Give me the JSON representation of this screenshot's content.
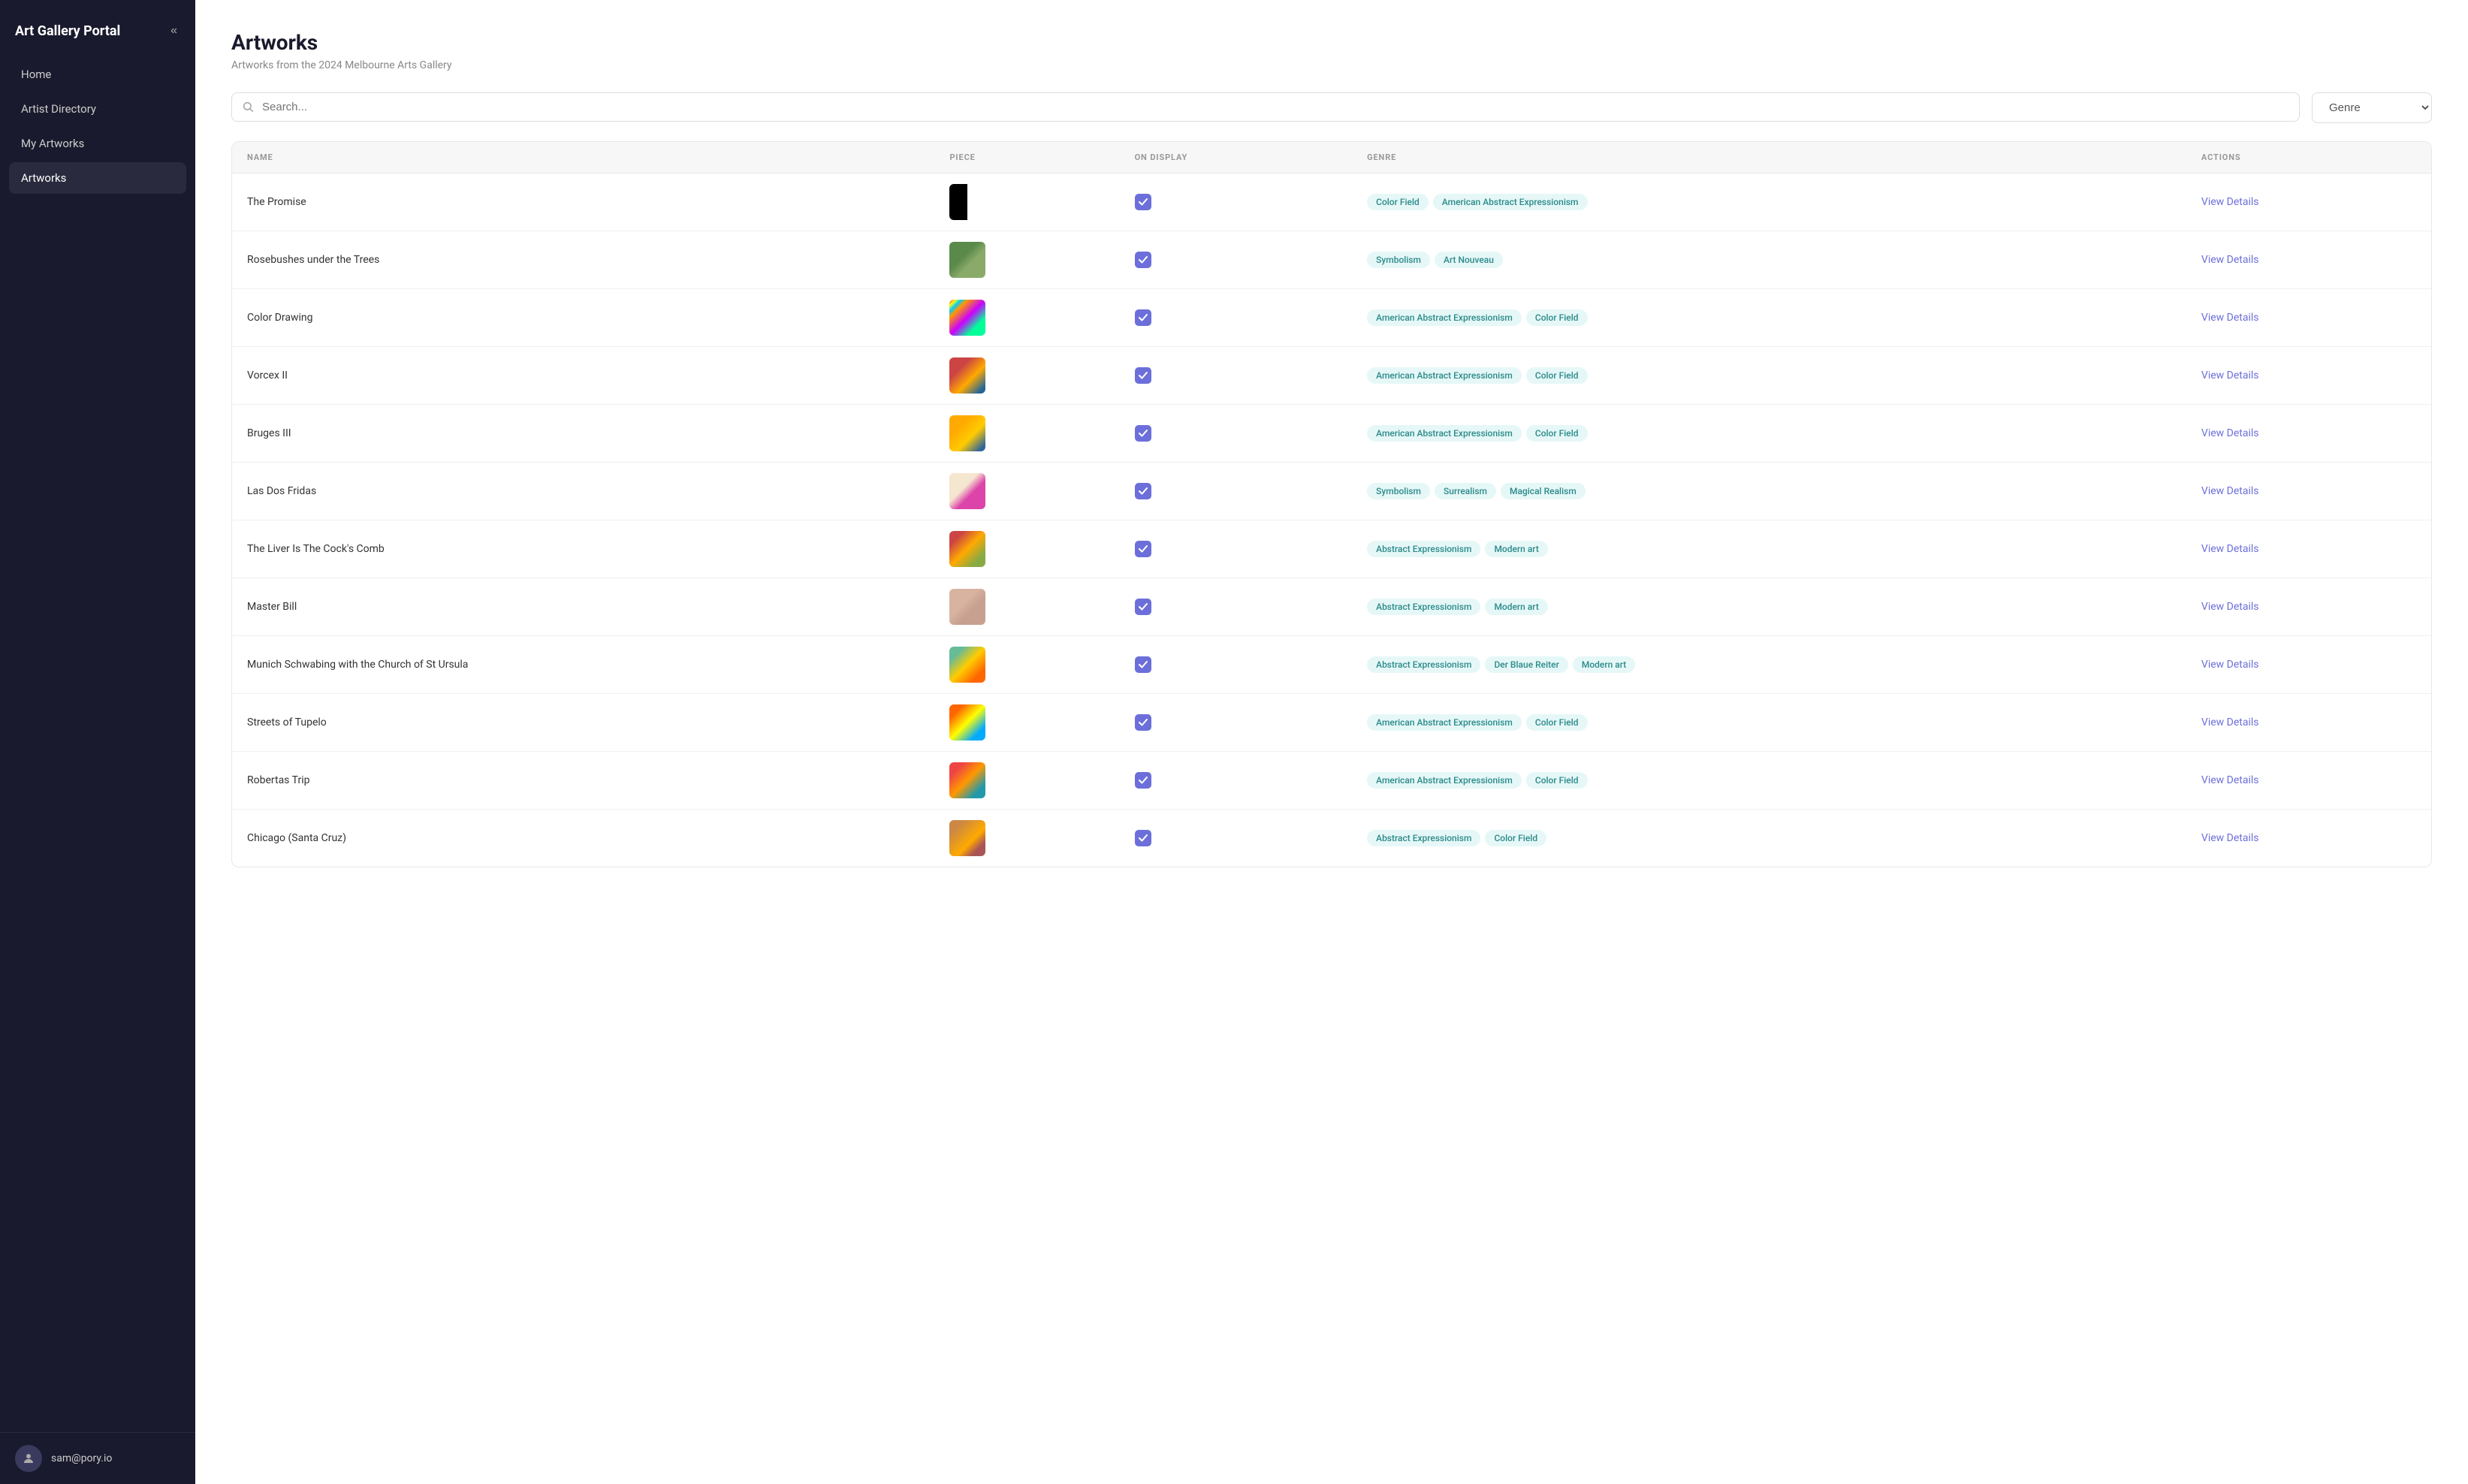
{
  "app": {
    "logo": "Art Gallery Portal",
    "collapse_icon": "«"
  },
  "sidebar": {
    "items": [
      {
        "id": "home",
        "label": "Home",
        "active": false
      },
      {
        "id": "artist-directory",
        "label": "Artist Directory",
        "active": false
      },
      {
        "id": "my-artworks",
        "label": "My Artworks",
        "active": false
      },
      {
        "id": "artworks",
        "label": "Artworks",
        "active": true
      }
    ]
  },
  "user": {
    "email": "sam@pory.io",
    "icon": "👤"
  },
  "page": {
    "title": "Artworks",
    "subtitle": "Artworks from the 2024 Melbourne Arts Gallery"
  },
  "search": {
    "placeholder": "Search...",
    "genre_placeholder": "Genre"
  },
  "table": {
    "columns": [
      "NAME",
      "PIECE",
      "ON DISPLAY",
      "GENRE",
      "ACTIONS"
    ],
    "rows": [
      {
        "name": "The Promise",
        "art_class": "art-1",
        "on_display": true,
        "genres": [
          "Color Field",
          "American Abstract Expressionism"
        ],
        "action": "View Details"
      },
      {
        "name": "Rosebushes under the Trees",
        "art_class": "art-2",
        "on_display": true,
        "genres": [
          "Symbolism",
          "Art Nouveau"
        ],
        "action": "View Details"
      },
      {
        "name": "Color Drawing",
        "art_class": "art-3",
        "on_display": true,
        "genres": [
          "American Abstract Expressionism",
          "Color Field"
        ],
        "action": "View Details"
      },
      {
        "name": "Vorcex II",
        "art_class": "art-4",
        "on_display": true,
        "genres": [
          "American Abstract Expressionism",
          "Color Field"
        ],
        "action": "View Details"
      },
      {
        "name": "Bruges III",
        "art_class": "art-5",
        "on_display": true,
        "genres": [
          "American Abstract Expressionism",
          "Color Field"
        ],
        "action": "View Details"
      },
      {
        "name": "Las Dos Fridas",
        "art_class": "art-6",
        "on_display": true,
        "genres": [
          "Symbolism",
          "Surrealism",
          "Magical Realism"
        ],
        "action": "View Details"
      },
      {
        "name": "The Liver Is The Cock's Comb",
        "art_class": "art-7",
        "on_display": true,
        "genres": [
          "Abstract Expressionism",
          "Modern art"
        ],
        "action": "View Details"
      },
      {
        "name": "Master Bill",
        "art_class": "art-8",
        "on_display": true,
        "genres": [
          "Abstract Expressionism",
          "Modern art"
        ],
        "action": "View Details"
      },
      {
        "name": "Munich Schwabing with the Church of St Ursula",
        "art_class": "art-9",
        "on_display": true,
        "genres": [
          "Abstract Expressionism",
          "Der Blaue Reiter",
          "Modern art"
        ],
        "action": "View Details"
      },
      {
        "name": "Streets of Tupelo",
        "art_class": "art-10",
        "on_display": true,
        "genres": [
          "American Abstract Expressionism",
          "Color Field"
        ],
        "action": "View Details"
      },
      {
        "name": "Robertas Trip",
        "art_class": "art-11",
        "on_display": true,
        "genres": [
          "American Abstract Expressionism",
          "Color Field"
        ],
        "action": "View Details"
      },
      {
        "name": "Chicago (Santa Cruz)",
        "art_class": "art-12",
        "on_display": true,
        "genres": [
          "Abstract Expressionism",
          "Color Field"
        ],
        "action": "View Details"
      }
    ]
  }
}
